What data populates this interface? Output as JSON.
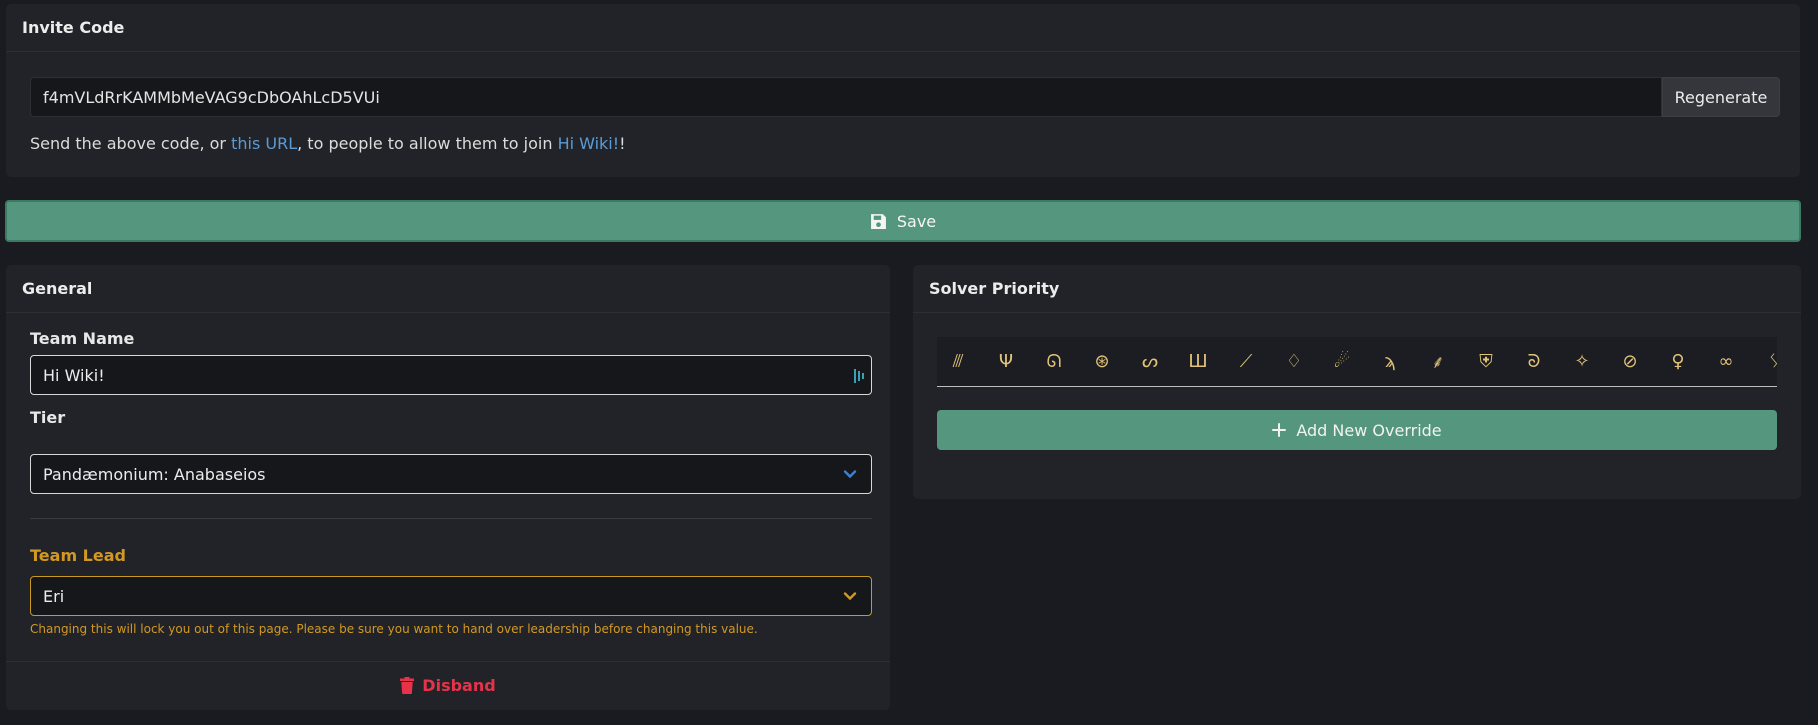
{
  "invite": {
    "title": "Invite Code",
    "code": "f4mVLdRrKAMMbMeVAG9cDbOAhLcD5VUi",
    "regenerate_label": "Regenerate",
    "help_prefix": "Send the above code, or ",
    "help_link1": "this URL",
    "help_middle": ", to people to allow them to join ",
    "help_link2": "Hi Wiki!",
    "help_suffix": "!"
  },
  "save": {
    "label": "Save"
  },
  "general": {
    "title": "General",
    "team_name_label": "Team Name",
    "team_name_value": "Hi Wiki!",
    "tier_label": "Tier",
    "tier_value": "Pandæmonium: Anabaseios",
    "team_lead_label": "Team Lead",
    "team_lead_value": "Eri",
    "team_lead_note": "Changing this will lock you out of this page. Please be sure you want to hand over leadership before changing this value.",
    "disband_label": "Disband"
  },
  "solver": {
    "title": "Solver Priority",
    "job_icons": [
      "claws-icon",
      "trident-icon",
      "swirl-icon",
      "spiral-icon",
      "bow-icon",
      "pillar-icon",
      "sword-icon",
      "diamond-icon",
      "flame-icon",
      "scythe-icon",
      "dagger-icon",
      "shield-icon",
      "chakram-icon",
      "star-icon",
      "slash-icon",
      "staff-icon",
      "glasses-icon",
      "partial-icon"
    ],
    "glyphs": [
      "⫻",
      "Ψ",
      "ᘏ",
      "⊛",
      "ᔕ",
      "Ш",
      "⟋",
      "♢",
      "☄",
      "ϡ",
      "⸙",
      "⛨",
      "ᘐ",
      "✧",
      "⊘",
      "♀",
      "∞",
      "ᛊ"
    ],
    "add_override_label": "Add New Override"
  },
  "colors": {
    "accent_green": "#55967f",
    "warning_gold": "#d29922",
    "danger_red": "#e8324a",
    "link_blue": "#5b9bd5",
    "job_gold": "#e2c478"
  }
}
